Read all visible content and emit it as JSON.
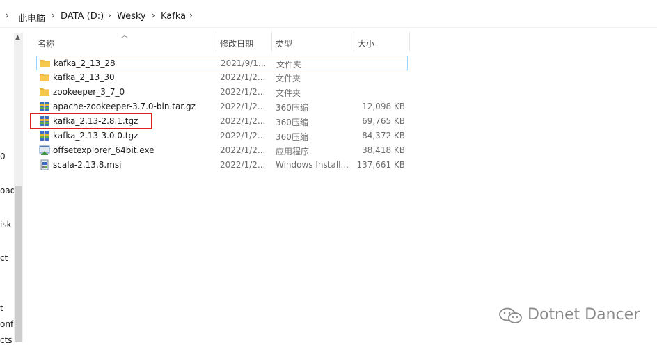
{
  "breadcrumb": {
    "items": [
      "此电脑",
      "DATA (D:)",
      "Wesky",
      "Kafka"
    ]
  },
  "nav_pane_fragments": [
    "0",
    "oad",
    "isk",
    "ct",
    "t",
    "onf",
    "cts"
  ],
  "columns": {
    "name": "名称",
    "date": "修改日期",
    "type": "类型",
    "size": "大小"
  },
  "files": [
    {
      "name": "kafka_2_13_28",
      "date": "2021/9/1...",
      "type": "文件夹",
      "size": "",
      "icon": "folder-icon"
    },
    {
      "name": "kafka_2_13_30",
      "date": "2022/1/2...",
      "type": "文件夹",
      "size": "",
      "icon": "folder-icon"
    },
    {
      "name": "zookeeper_3_7_0",
      "date": "2022/1/2...",
      "type": "文件夹",
      "size": "",
      "icon": "folder-icon"
    },
    {
      "name": "apache-zookeeper-3.7.0-bin.tar.gz",
      "date": "2022/1/2...",
      "type": "360压缩",
      "size": "12,098 KB",
      "icon": "archive-icon"
    },
    {
      "name": "kafka_2.13-2.8.1.tgz",
      "date": "2022/1/2...",
      "type": "360压缩",
      "size": "69,765 KB",
      "icon": "archive-icon"
    },
    {
      "name": "kafka_2.13-3.0.0.tgz",
      "date": "2022/1/2...",
      "type": "360压缩",
      "size": "84,372 KB",
      "icon": "archive-icon"
    },
    {
      "name": "offsetexplorer_64bit.exe",
      "date": "2022/1/2...",
      "type": "应用程序",
      "size": "38,418 KB",
      "icon": "exe-icon"
    },
    {
      "name": "scala-2.13.8.msi",
      "date": "2022/1/2...",
      "type": "Windows Install...",
      "size": "137,661 KB",
      "icon": "msi-icon"
    }
  ],
  "watermark": "Dotnet Dancer",
  "colors": {
    "selection_border": "#99d1ff",
    "highlight_box": "#e02020",
    "folder": "#f6c94c"
  }
}
